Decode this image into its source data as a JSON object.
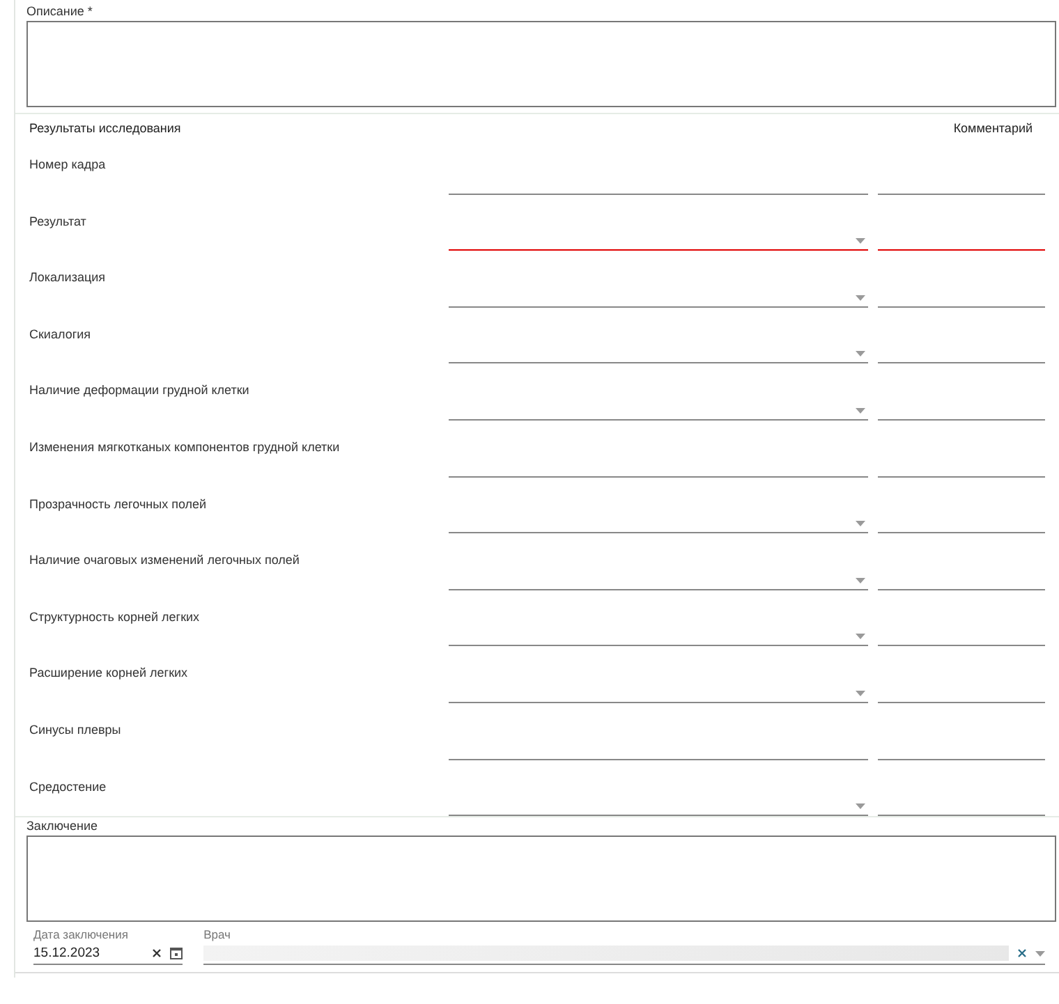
{
  "description": {
    "label": "Описание *"
  },
  "results": {
    "title": "Результаты исследования",
    "comment_header": "Комментарий",
    "rows": [
      {
        "label": "Номер кадра",
        "kind": "text",
        "error": false
      },
      {
        "label": "Результат",
        "kind": "select",
        "error": true
      },
      {
        "label": "Локализация",
        "kind": "select",
        "error": false
      },
      {
        "label": "Скиалогия",
        "kind": "select",
        "error": false
      },
      {
        "label": "Наличие деформации грудной клетки",
        "kind": "select",
        "error": false
      },
      {
        "label": "Изменения мягкотканых компонентов грудной клетки",
        "kind": "text",
        "error": false
      },
      {
        "label": "Прозрачность легочных полей",
        "kind": "select",
        "error": false
      },
      {
        "label": "Наличие очаговых изменений легочных полей",
        "kind": "select",
        "error": false
      },
      {
        "label": "Структурность корней легких",
        "kind": "select",
        "error": false
      },
      {
        "label": "Расширение корней легких",
        "kind": "select",
        "error": false
      },
      {
        "label": "Синусы плевры",
        "kind": "text",
        "error": false
      },
      {
        "label": "Средостение",
        "kind": "select",
        "error": false
      }
    ]
  },
  "conclusion": {
    "label": "Заключение"
  },
  "date": {
    "label": "Дата заключения",
    "value": "15.12.2023"
  },
  "doctor": {
    "label": "Врач",
    "redacted": true
  }
}
